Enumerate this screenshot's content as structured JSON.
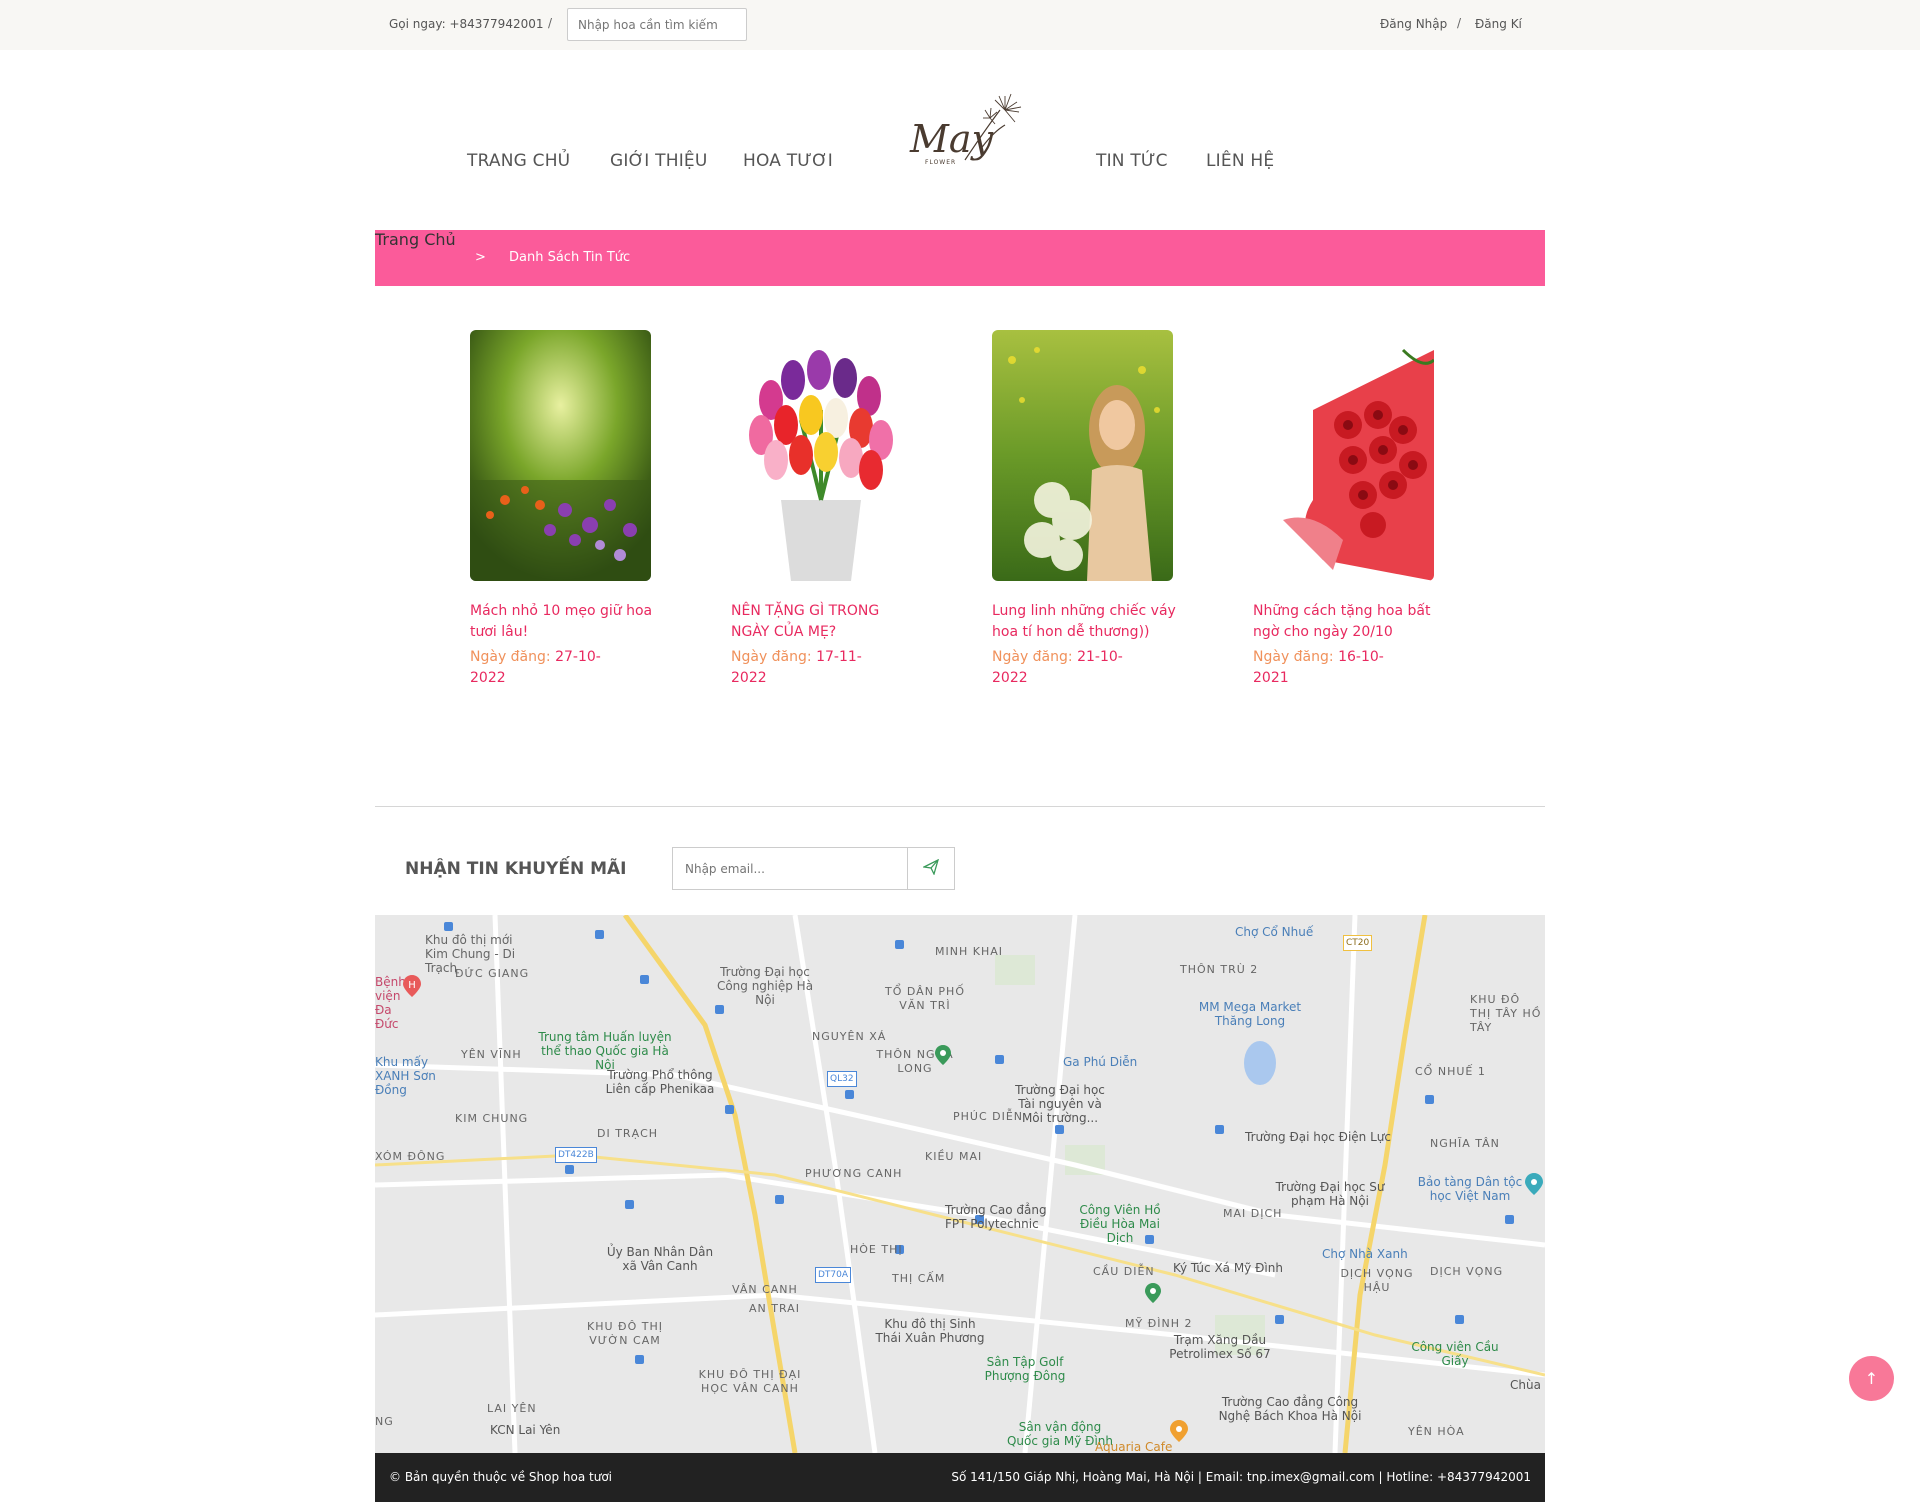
{
  "topbar": {
    "phone": "Gọi ngay: +84377942001",
    "separator": "/",
    "search_placeholder": "Nhập hoa cần tìm kiếm",
    "login": "Đăng Nhập",
    "register": "Đăng Kí"
  },
  "nav": {
    "items": [
      "TRANG CHỦ",
      "GIỚI THIỆU",
      "HOA TƯƠI",
      "TIN TỨC",
      "LIÊN HỆ"
    ],
    "logo_text": "May",
    "logo_sub": "FLOWER"
  },
  "breadcrumb": {
    "home": "Trang Chủ",
    "separator": ">",
    "current": "Danh Sách Tin Tức"
  },
  "articles": [
    {
      "title": "Mách nhỏ 10 mẹo giữ hoa tươi lâu!",
      "date_label": "Ngày đăng:",
      "date": "27-10-2022"
    },
    {
      "title": "NÊN TẶNG GÌ TRONG NGÀY CỦA MẸ?",
      "date_label": "Ngày đăng:",
      "date": "17-11-2022"
    },
    {
      "title": "Lung linh những chiếc váy hoa tí hon dễ thương))",
      "date_label": "Ngày đăng:",
      "date": "21-10-2022"
    },
    {
      "title": "Những cách tặng hoa bất ngờ cho ngày 20/10",
      "date_label": "Ngày đăng:",
      "date": "16-10-2021"
    }
  ],
  "newsletter": {
    "label": "NHẬN TIN KHUYẾN MÃI",
    "placeholder": "Nhập email..."
  },
  "map": {
    "labels": [
      "Khu đô thị mới Kim Chung - Di Trạch",
      "ĐỨC GIANG",
      "Trường Đại học Công nghiệp Hà Nội",
      "MINH KHAI",
      "TỔ DÂN PHỐ VĂN TRÌ",
      "THÔN TRÙ 2",
      "Chợ Cổ Nhuế",
      "KHU ĐÔ THỊ TÂY HỒ TÂY",
      "Trung tâm Huấn luyện thể thao Quốc gia Hà Nội",
      "NGUYÊN XÁ",
      "THÔN NGỌA LONG",
      "MM Mega Market Thăng Long",
      "YÊN VĨNH",
      "Trường Phổ thông Liên cấp Phenikaa",
      "Ga Phú Diễn",
      "CỔ NHUẾ 1",
      "KIM CHUNG",
      "PHÚC DIỄN",
      "Trường Đại học Tài nguyên và Môi trường...",
      "DI TRẠCH",
      "KIỀU MAI",
      "Trường Đại học Điện Lực",
      "NGHĨA TÂN",
      "XÓM ĐÔNG",
      "PHƯƠNG CANH",
      "Trường Đại học Sư phạm Hà Nội",
      "Bảo tàng Dân tộc học Việt Nam",
      "Trường Cao đẳng FPT Polytechnic",
      "Công Viên Hồ Điều Hòa Mai Dịch",
      "MAI DỊCH",
      "Ủy Ban Nhân Dân xã Vân Canh",
      "HÒE THỊ",
      "Chợ Nhà Xanh",
      "CẦU DIỄN",
      "Ký Túc Xá Mỹ Đình",
      "DỊCH VỌNG HẬU",
      "DỊCH VỌNG",
      "VÂN CANH",
      "THỊ CẤM",
      "AN TRAI",
      "MỸ ĐÌNH 2",
      "KHU ĐÔ THỊ VƯỜN CAM",
      "Khu đô thị Sinh Thái Xuân Phương",
      "Trạm Xăng Dầu Petrolimex Số 67",
      "Công viên Cầu Giấy",
      "Sân Tập Golf Phượng Đông",
      "KHU ĐÔ THỊ ĐẠI HỌC VÂN CANH",
      "Trường Cao đẳng Công Nghệ Bách Khoa Hà Nội",
      "LAI YÊN",
      "KCN Lai Yên",
      "Sân vận động Quốc gia Mỹ Đình",
      "Aquaria Cafe",
      "YÊN HÒA",
      "Chùa L",
      "Bệnh viện Đa Đức",
      "Khu mấy XANH Sơn Đồng",
      "NG"
    ],
    "road_badges": [
      "CT20",
      "QL32",
      "DT422B",
      "DT70A"
    ]
  },
  "footer": {
    "copyright": "© Bản quyền thuộc về Shop hoa tươi",
    "contact": "Số 141/150 Giáp Nhị, Hoàng Mai, Hà Nội | Email: tnp.imex@gmail.com | Hotline: +84377942001"
  },
  "back_to_top": "↑"
}
